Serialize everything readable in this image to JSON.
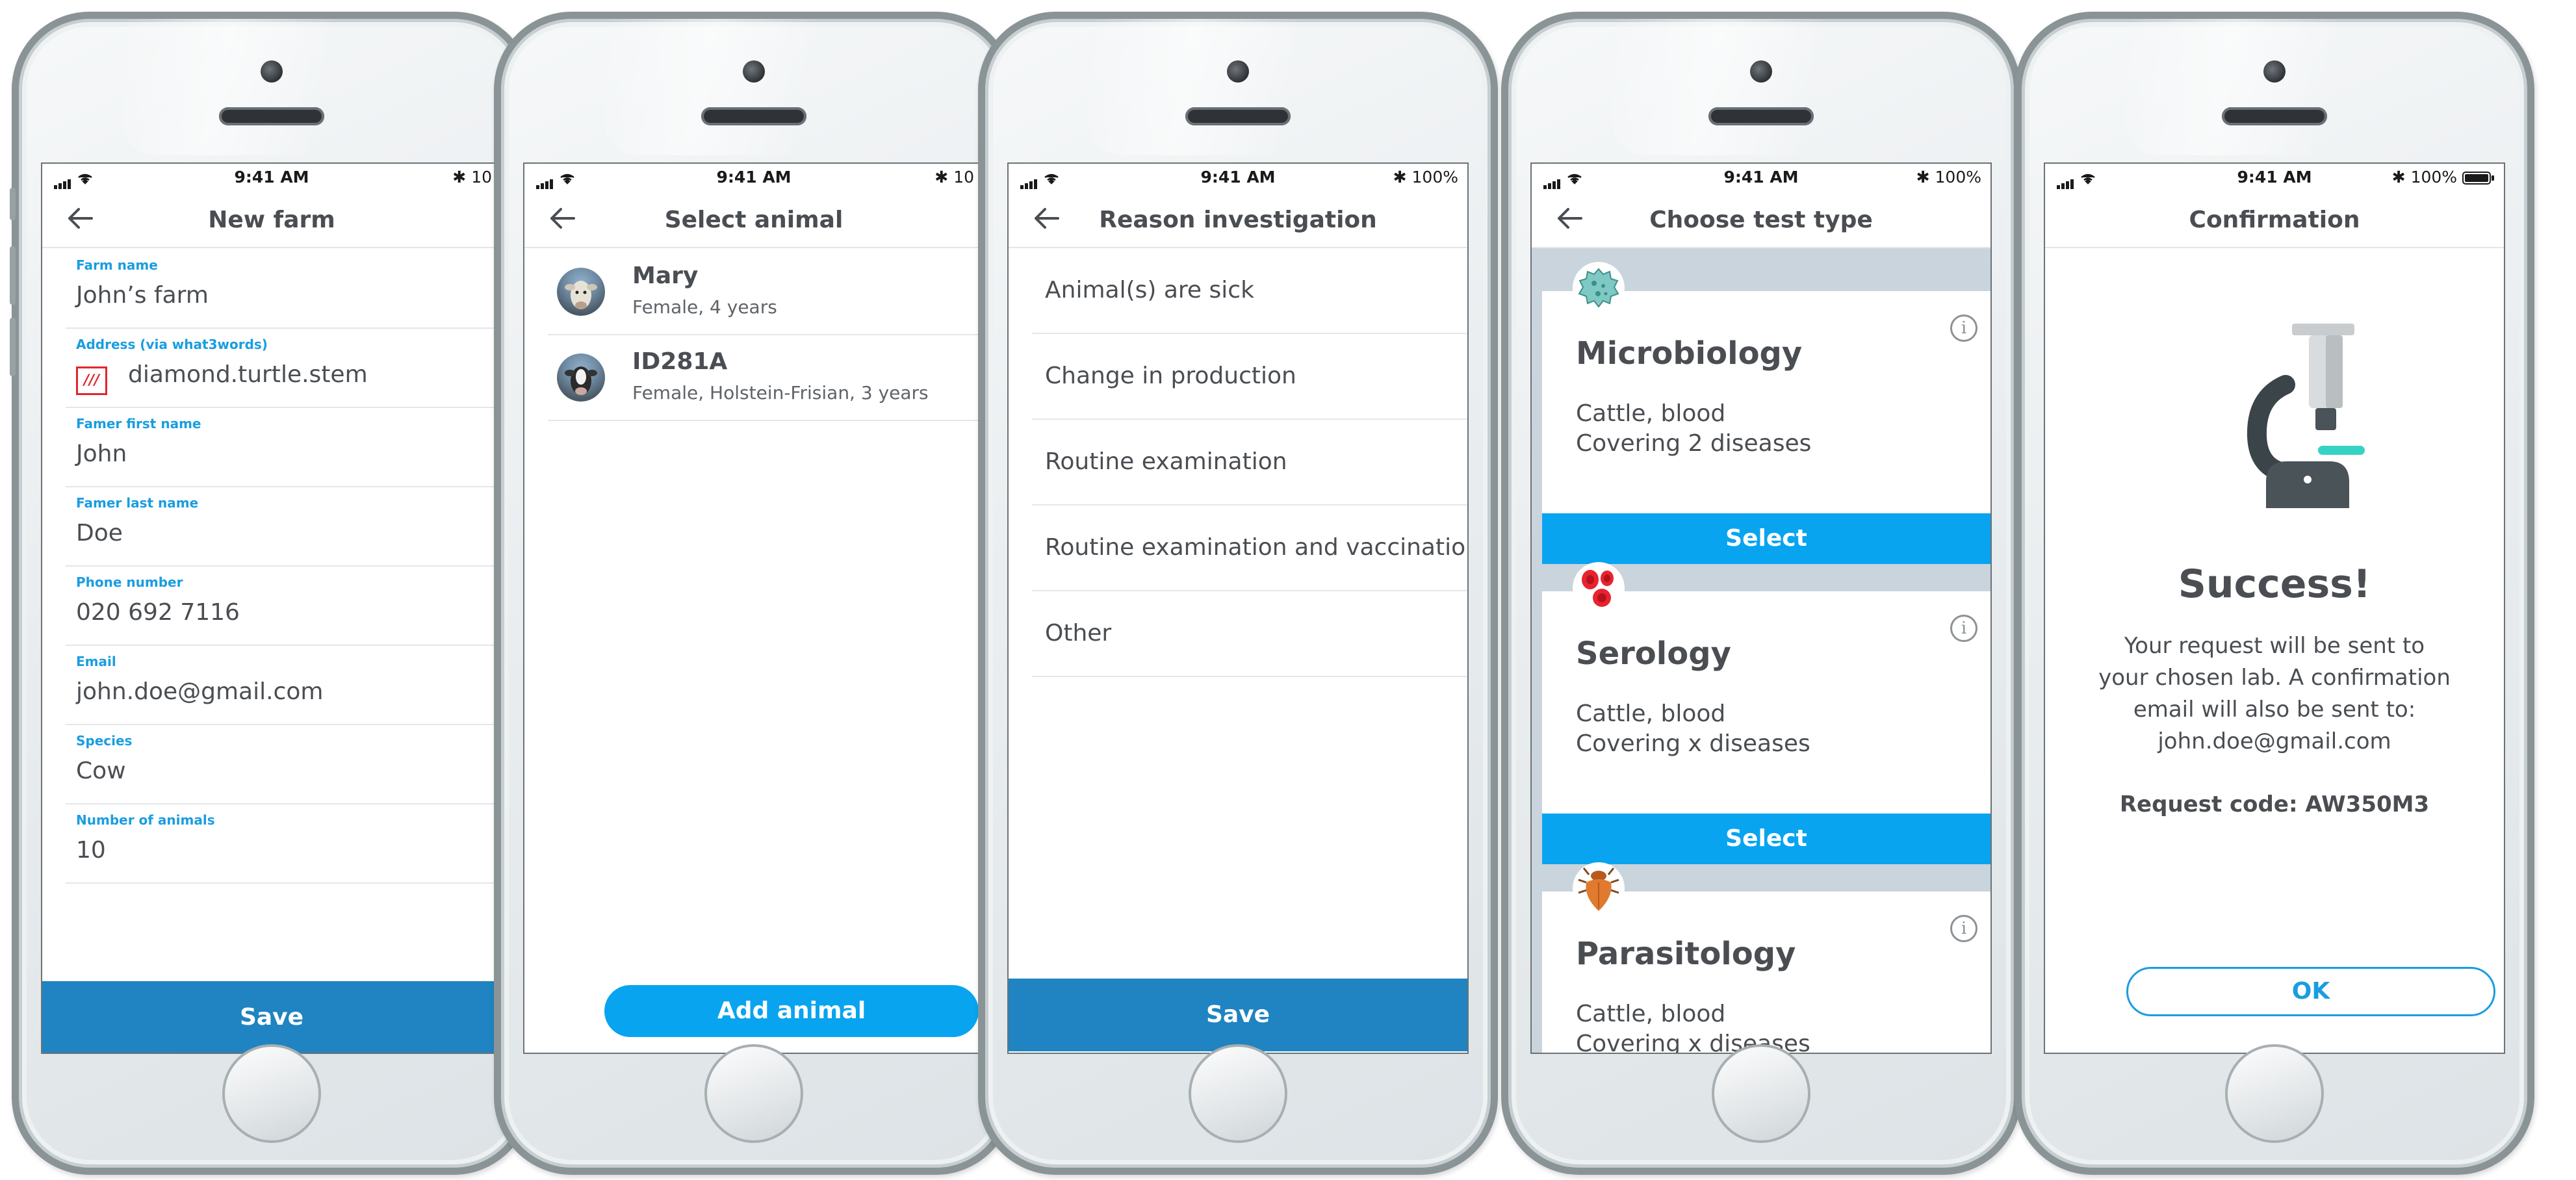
{
  "status": {
    "time": "9:41 AM",
    "battery_full": "100%",
    "battery_clipped_1": "10",
    "battery_clipped_2": "100% "
  },
  "screen1": {
    "title": "New farm",
    "fields": [
      {
        "label": "Farm name",
        "value": "John’s farm"
      },
      {
        "label": "Address (via what3words)",
        "value": "diamond.turtle.stem"
      },
      {
        "label": "Famer first name",
        "value": "John"
      },
      {
        "label": "Famer last name",
        "value": "Doe"
      },
      {
        "label": "Phone number",
        "value": "020 692 7116"
      },
      {
        "label": "Email",
        "value": "john.doe@gmail.com"
      },
      {
        "label": "Species",
        "value": "Cow"
      },
      {
        "label": "Number of animals",
        "value": "10"
      }
    ],
    "w3w_logo": "///",
    "save_label": "Save"
  },
  "screen2": {
    "title": "Select animal",
    "animals": [
      {
        "name": "Mary",
        "detail": "Female, 4 years"
      },
      {
        "name": "ID281A",
        "detail": "Female, Holstein-Frisian, 3 years"
      }
    ],
    "add_label": "Add animal"
  },
  "screen3": {
    "title": "Reason investigation",
    "reasons": [
      "Animal(s) are sick",
      "Change in production",
      "Routine examination",
      "Routine examination and vaccination",
      "Other"
    ],
    "save_label": "Save"
  },
  "screen4": {
    "title": "Choose test type",
    "tests": [
      {
        "title": "Microbiology",
        "line1": "Cattle, blood",
        "line2": "Covering 2 diseases",
        "icon": "bacteria-icon"
      },
      {
        "title": "Serology",
        "line1": "Cattle, blood",
        "line2": "Covering x diseases",
        "icon": "blood-cells-icon"
      },
      {
        "title": "Parasitology",
        "line1": "Cattle, blood",
        "line2": "Covering x diseases",
        "icon": "tick-parasite-icon"
      }
    ],
    "select_label": "Select",
    "info_glyph": "i",
    "colors": {
      "select": "#08a4f0",
      "card_bg": "#c9d4dc"
    }
  },
  "screen5": {
    "title": "Confirmation",
    "heading": "Success!",
    "message_lines": [
      "Your request will be sent to",
      "your chosen lab. A confirmation",
      "email will also be sent to:",
      "john.doe@gmail.com"
    ],
    "request_code": "Request code: AW350M3",
    "ok_label": "OK",
    "icon": "microscope-icon"
  }
}
